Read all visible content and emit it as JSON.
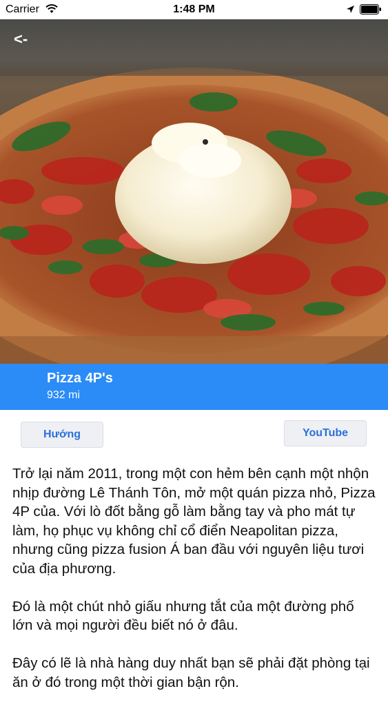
{
  "status_bar": {
    "carrier": "Carrier",
    "time": "1:48 PM"
  },
  "nav": {
    "back_label": "<-"
  },
  "place": {
    "name": "Pizza 4P's",
    "distance": "932 mi"
  },
  "actions": {
    "directions_label": "Hướng",
    "youtube_label": "YouTube"
  },
  "description": {
    "paragraphs": [
      "Trở lại năm 2011, trong một con hẻm bên cạnh một nhộn nhịp đường Lê Thánh Tôn, mở một quán pizza nhỏ, Pizza 4P của. Với lò đốt bằng gỗ làm bằng tay và pho mát tự làm, họ phục vụ không chỉ cổ điển Neapolitan pizza, nhưng cũng pizza fusion Á ban đầu với nguyên liệu tươi của địa phương.",
      "Đó là một chút nhỏ giấu nhưng tắt của một đường phố lớn và mọi người đều biết nó ở đâu.",
      "Đây có lẽ là nhà hàng duy nhất bạn sẽ phải đặt phòng tại ăn ở đó trong một thời gian bận rộn."
    ]
  },
  "colors": {
    "title_bar": "#2b8cf7",
    "button_text": "#2a6fdb",
    "button_bg": "#eef0f4"
  }
}
